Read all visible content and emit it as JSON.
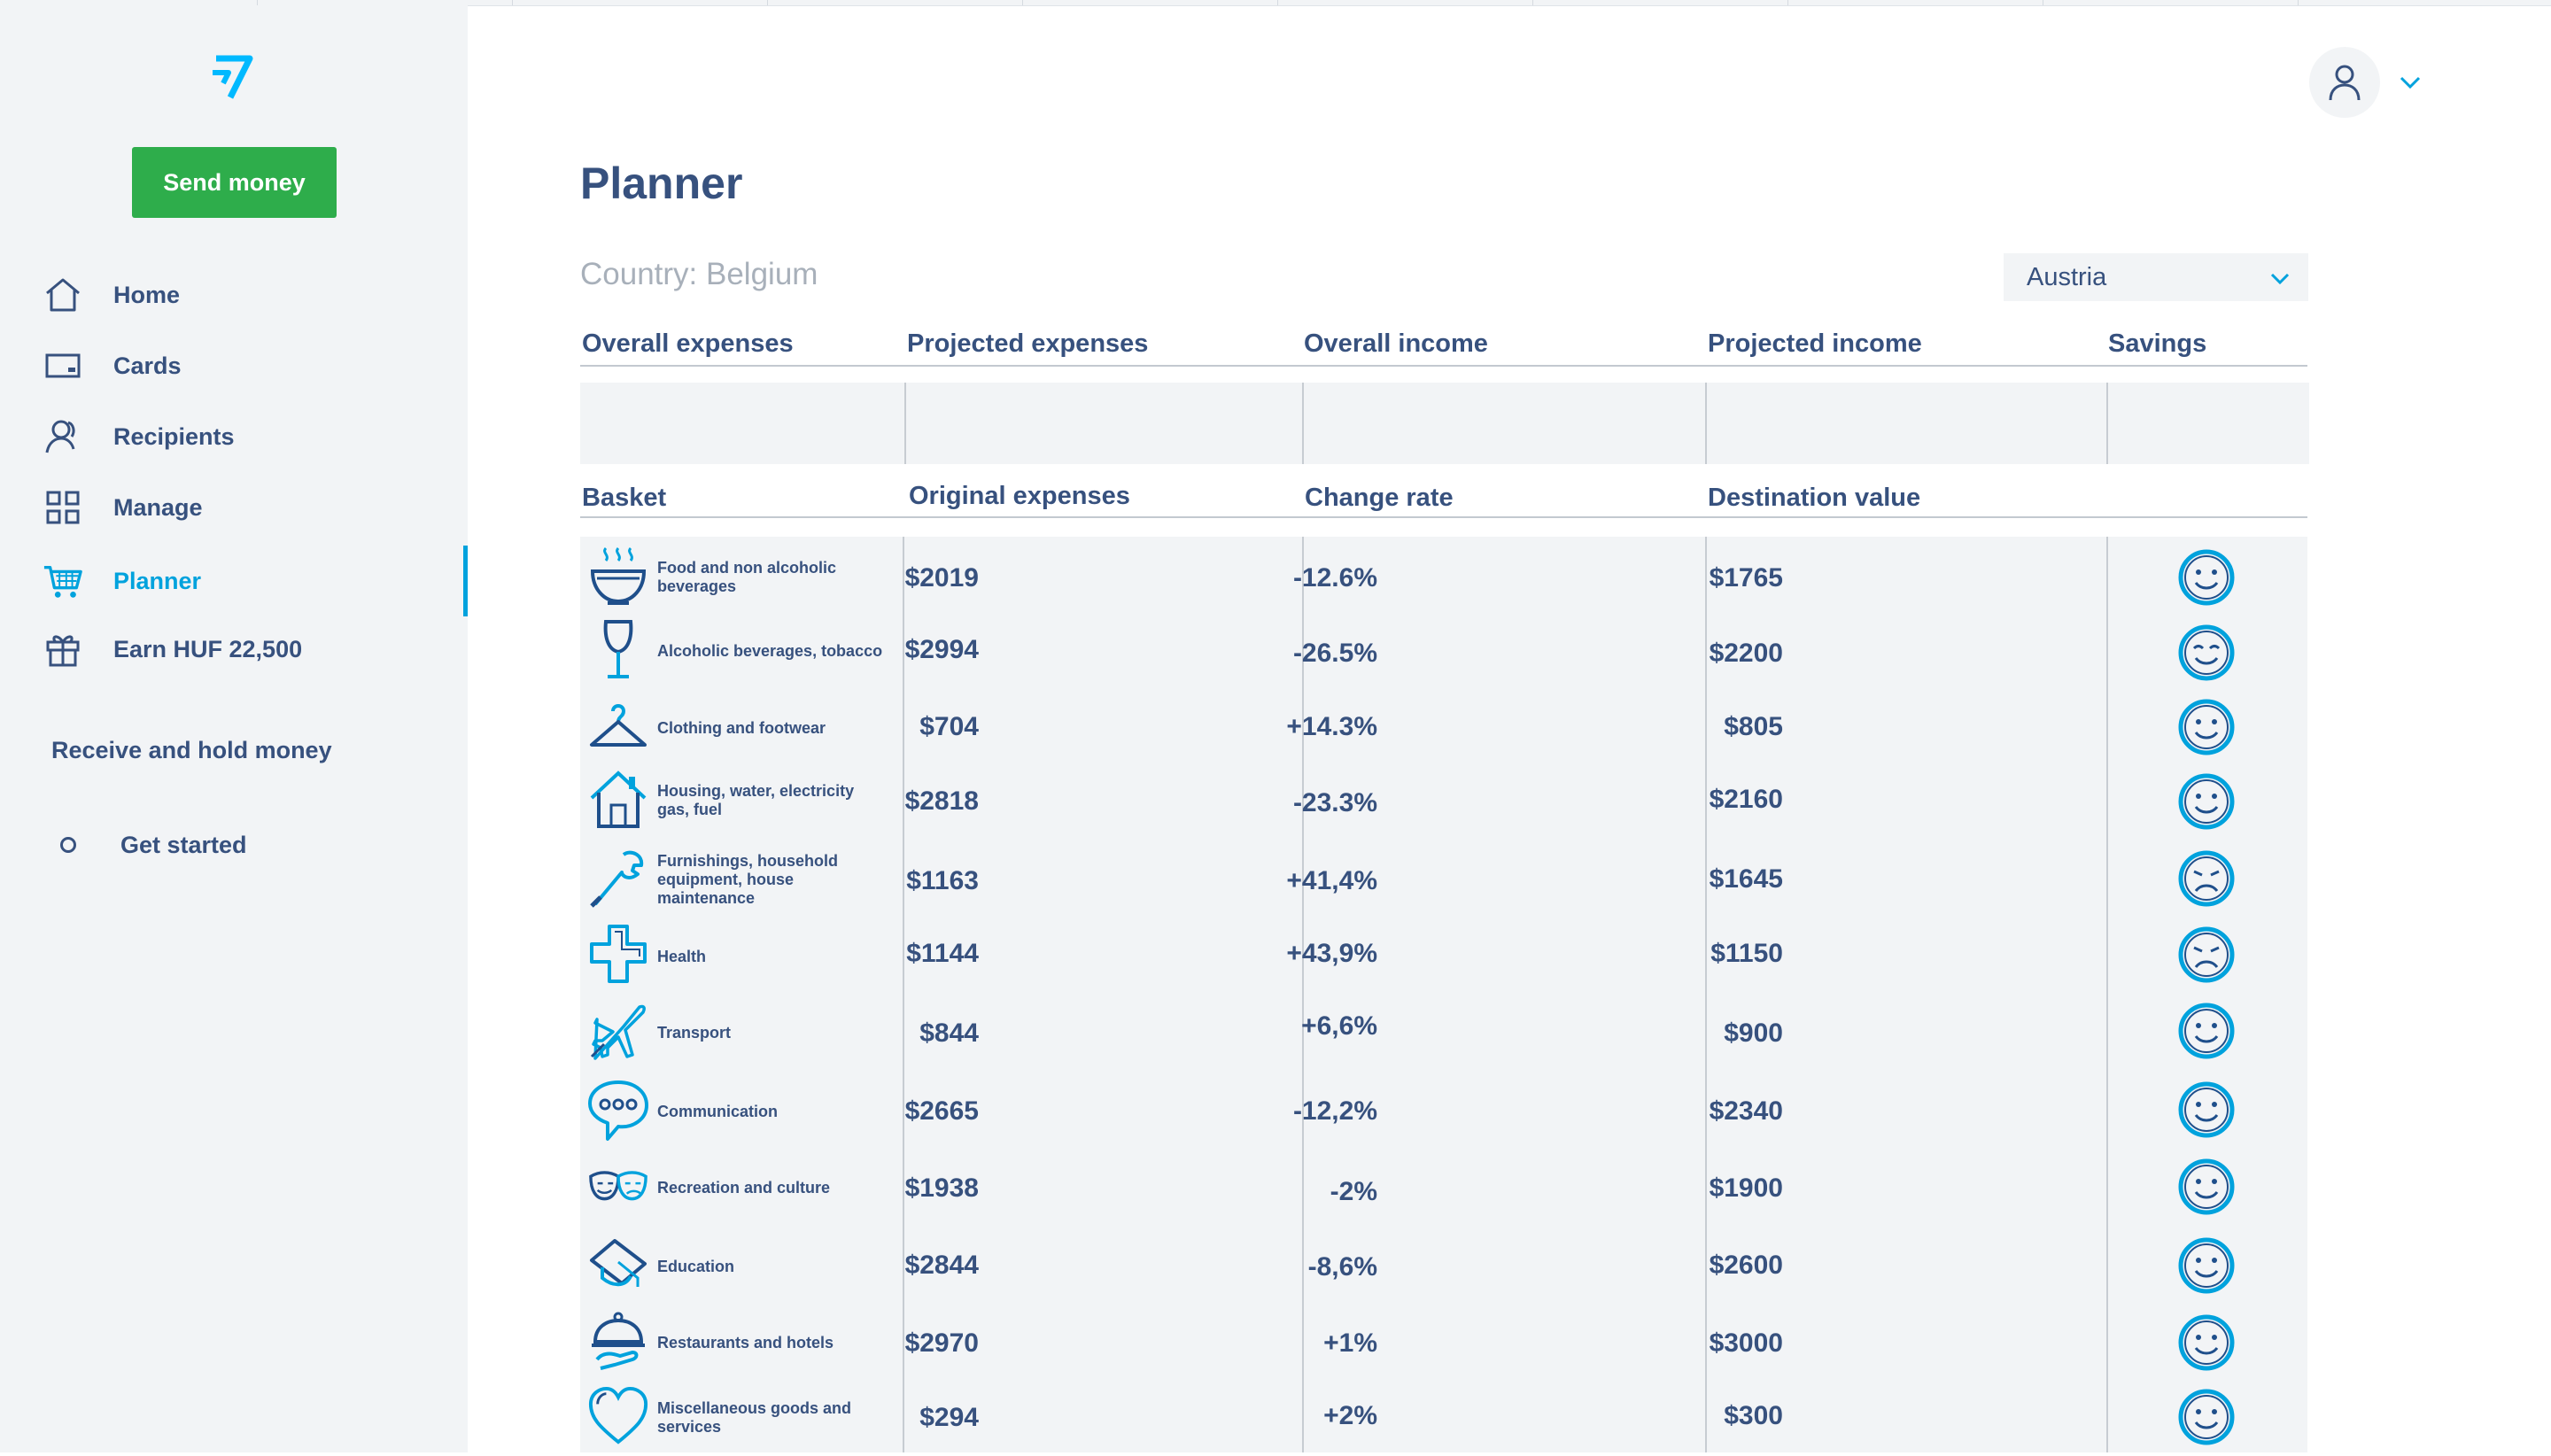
{
  "sidebar": {
    "logo": "wise-logo",
    "send_button": "Send money",
    "nav": [
      {
        "label": "Home",
        "icon": "home-icon"
      },
      {
        "label": "Cards",
        "icon": "card-icon"
      },
      {
        "label": "Recipients",
        "icon": "recipients-icon"
      },
      {
        "label": "Manage",
        "icon": "grid-icon"
      },
      {
        "label": "Planner",
        "icon": "cart-icon",
        "active": true
      },
      {
        "label": "Earn HUF 22,500",
        "icon": "gift-icon"
      }
    ],
    "section_title": "Receive and hold money",
    "get_started": "Get started"
  },
  "header": {
    "avatar": "user-icon"
  },
  "planner": {
    "title": "Planner",
    "country_label": "Country: Belgium",
    "destination_select": "Austria",
    "summary_headers": [
      "Overall expenses",
      "Projected expenses",
      "Overall income",
      "Projected income",
      "Savings"
    ],
    "table_headers": [
      "Basket",
      "Original expenses",
      "Change rate",
      "Destination value"
    ],
    "rows": [
      {
        "category": "Food and non alcoholic beverages",
        "icon": "bowl-icon",
        "original": "$2019",
        "rate": "-12.6%",
        "destination": "$1765",
        "mood": "happy"
      },
      {
        "category": "Alcoholic beverages, tobacco",
        "icon": "wine-glass-icon",
        "original": "$2994",
        "rate": "-26.5%",
        "destination": "$2200",
        "mood": "content"
      },
      {
        "category": "Clothing and footwear",
        "icon": "hanger-icon",
        "original": "$704",
        "rate": "+14.3%",
        "destination": "$805",
        "mood": "happy"
      },
      {
        "category": "Housing, water, electricity gas, fuel",
        "icon": "house-icon",
        "original": "$2818",
        "rate": "-23.3%",
        "destination": "$2160",
        "mood": "happy"
      },
      {
        "category": "Furnishings, household equipment, house maintenance",
        "icon": "wrench-icon",
        "original": "$1163",
        "rate": "+41,4%",
        "destination": "$1645",
        "mood": "sad"
      },
      {
        "category": "Health",
        "icon": "cross-icon",
        "original": "$1144",
        "rate": "+43,9%",
        "destination": "$1150",
        "mood": "sad"
      },
      {
        "category": "Transport",
        "icon": "plane-icon",
        "original": "$844",
        "rate": "+6,6%",
        "destination": "$900",
        "mood": "happy"
      },
      {
        "category": "Communication",
        "icon": "speech-bubble-icon",
        "original": "$2665",
        "rate": "-12,2%",
        "destination": "$2340",
        "mood": "happy"
      },
      {
        "category": "Recreation and culture",
        "icon": "theater-masks-icon",
        "original": "$1938",
        "rate": "-2%",
        "destination": "$1900",
        "mood": "happy"
      },
      {
        "category": "Education",
        "icon": "graduation-cap-icon",
        "original": "$2844",
        "rate": "-8,6%",
        "destination": "$2600",
        "mood": "happy"
      },
      {
        "category": "Restaurants and hotels",
        "icon": "cloche-icon",
        "original": "$2970",
        "rate": "+1%",
        "destination": "$3000",
        "mood": "happy"
      },
      {
        "category": "Miscellaneous goods and services",
        "icon": "heart-icon",
        "original": "$294",
        "rate": "+2%",
        "destination": "$300",
        "mood": "happy"
      }
    ]
  },
  "colors": {
    "accent": "#00a2dd",
    "text": "#37517e",
    "send_button": "#2ead4b",
    "panel": "#f2f4f6",
    "muted": "#a8b0ba"
  }
}
